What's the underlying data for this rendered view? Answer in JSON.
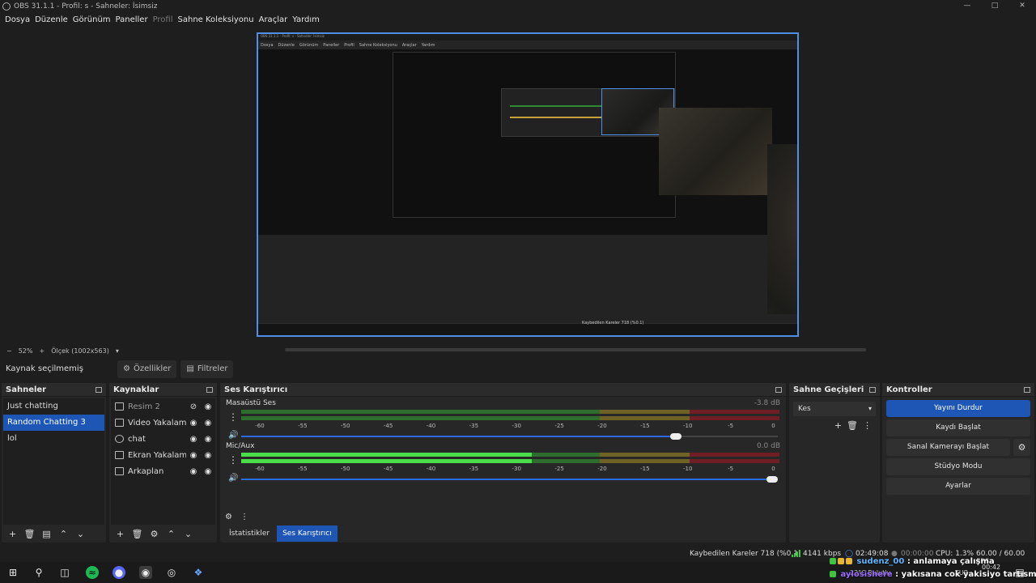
{
  "window": {
    "title": "OBS 31.1.1 - Profil: s - Sahneler: İsimsiz"
  },
  "menu": [
    "Dosya",
    "Düzenle",
    "Görünüm",
    "Paneller",
    "Profil",
    "Sahne Koleksiyonu",
    "Araçlar",
    "Yardım"
  ],
  "zoom": {
    "minus": "−",
    "value": "52%",
    "plus": "+",
    "scale": "Ölçek (1002x563)"
  },
  "source_toolbar": {
    "no_selection": "Kaynak seçilmemiş",
    "properties": "Özellikler",
    "filters": "Filtreler"
  },
  "scenes": {
    "title": "Sahneler",
    "items": [
      "Just chatting",
      "Random Chatting 3",
      "lol"
    ],
    "selected_index": 1
  },
  "sources": {
    "title": "Kaynaklar",
    "items": [
      {
        "name": "Resim 2",
        "icon": "image-icon",
        "visible": false
      },
      {
        "name": "Video Yakalama Ay",
        "icon": "camera-icon",
        "visible": true
      },
      {
        "name": "chat",
        "icon": "globe-icon",
        "visible": true
      },
      {
        "name": "Ekran Yakalama",
        "icon": "monitor-icon",
        "visible": true
      },
      {
        "name": "Arkaplan",
        "icon": "image-icon",
        "visible": true
      }
    ]
  },
  "mixer": {
    "title": "Ses Karıştırıcı",
    "ticks": [
      "-60",
      "-55",
      "-50",
      "-45",
      "-40",
      "-35",
      "-30",
      "-25",
      "-20",
      "-15",
      "-10",
      "-5",
      "0"
    ],
    "channels": [
      {
        "name": "Masaüstü Ses",
        "db": "-3.8 dB",
        "level": 0.0,
        "volume": 0.82
      },
      {
        "name": "Mic/Aux",
        "db": "0.0 dB",
        "level": 0.54,
        "volume": 1.0
      }
    ],
    "tabs": [
      "İstatistikler",
      "Ses Karıştırıcı"
    ],
    "active_tab": 1
  },
  "transitions": {
    "title": "Sahne Geçişleri",
    "selected": "Kes"
  },
  "controls": {
    "title": "Kontroller",
    "buttons": [
      "Yayını Durdur",
      "Kaydı Başlat",
      "Sanal Kamerayı Başlat",
      "Stüdyo Modu",
      "Ayarlar"
    ]
  },
  "status": {
    "dropped": "Kaybedilen Kareler 718 (%0.1)",
    "bitrate": "4141 kbps",
    "stream_time": "02:49:08",
    "rec_time": "00:00:00",
    "cpu": "CPU: 1.3%",
    "fps": "60.00 / 60.00 FPS"
  },
  "taskbar": {
    "weather": "22°C  Bulutlu",
    "lang": "TUR",
    "clock": "00:42",
    "chat": [
      {
        "user": "sudenz_00",
        "text": " : anlamaya çalışma"
      },
      {
        "user": "aylosishere",
        "text": " : yakısana cok yakisiyo tartısmam bile"
      }
    ]
  },
  "preview_capture": {
    "menu": [
      "Dosya",
      "Düzenle",
      "Görünüm",
      "Paneller",
      "Profil",
      "Sahne Koleksiyonu",
      "Araçlar",
      "Yardım"
    ],
    "title": "OBS 31.1.1 - Profil: s - Sahneler: İsimsiz",
    "status": "Kaybedilen Kareler 718 (%0.1)"
  },
  "colors": {
    "accent": "#1e56b6",
    "preview_border": "#4f8fe6",
    "bg": "#1f1e1f",
    "panel": "#272727"
  }
}
